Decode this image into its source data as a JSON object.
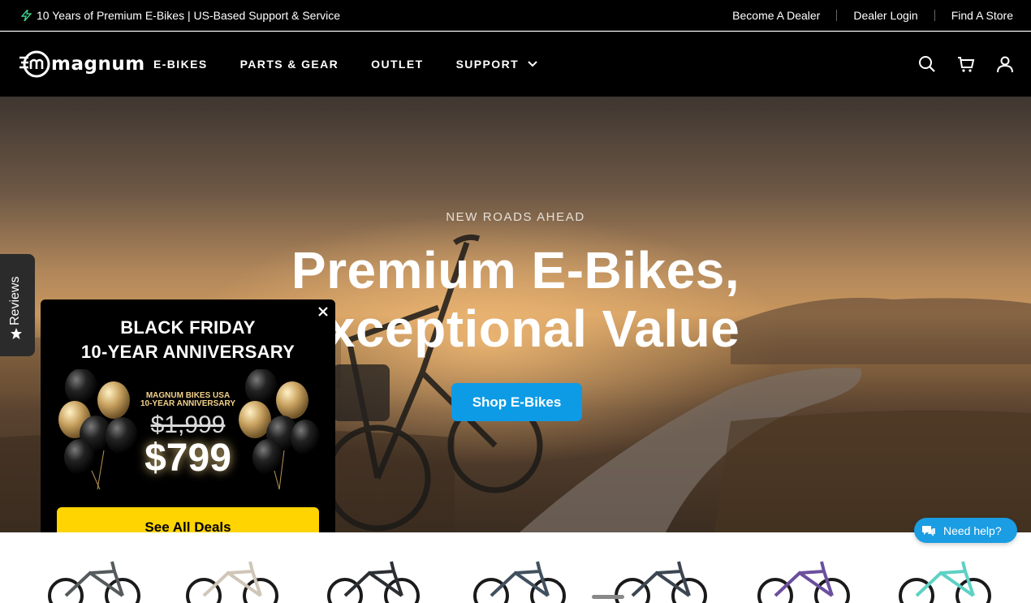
{
  "topbar": {
    "announcement": "10 Years of Premium E-Bikes | US-Based Support & Service",
    "links": [
      "Become A Dealer",
      "Dealer Login",
      "Find A Store"
    ]
  },
  "header": {
    "logo": "magnum",
    "nav": [
      "E-BIKES",
      "PARTS & GEAR",
      "OUTLET",
      "SUPPORT"
    ],
    "icons": [
      "search-icon",
      "cart-icon",
      "account-icon"
    ]
  },
  "hero": {
    "eyebrow": "NEW ROADS AHEAD",
    "title_line1": "Premium E-Bikes,",
    "title_line2": "Exceptional Value",
    "cta": "Shop E-Bikes"
  },
  "reviews_tab": {
    "label": "Reviews",
    "icon": "star-icon"
  },
  "popup": {
    "title_line1": "BLACK FRIDAY",
    "title_line2": "10-YEAR ANNIVERSARY",
    "brand_line1": "MAGNUM BIKES USA",
    "brand_line2": "10-YEAR ANNIVERSARY",
    "old_price": "$1,999",
    "new_price": "$799",
    "button": "See All Deals",
    "close_icon": "close-icon"
  },
  "help_button": {
    "label": "Need help?",
    "icon": "chat-icon"
  },
  "bike_colors": [
    "#555a5c",
    "#cfc6b8",
    "#2b2f33",
    "#41505e",
    "#3c4652",
    "#6b4f9e",
    "#5ed1c4"
  ],
  "colors": {
    "accent": "#0d9be6",
    "deal_yellow": "#ffd400",
    "help_blue": "#1a9de3"
  }
}
